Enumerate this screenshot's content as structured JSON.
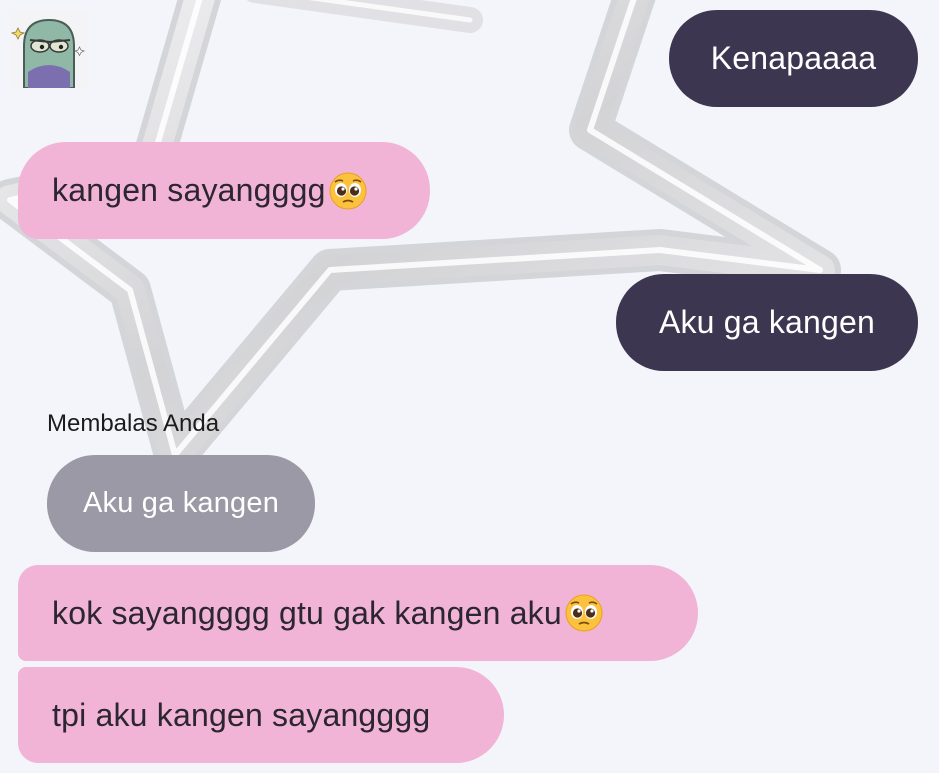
{
  "chat": {
    "contact_avatar": "cartoon-character-avatar",
    "messages": [
      {
        "sender": "me",
        "text": "Kenapaaaa"
      },
      {
        "sender": "contact",
        "text": "kangen sayangggg",
        "emoji": "pleading-face-emoji"
      },
      {
        "sender": "me",
        "text": "Aku ga kangen"
      },
      {
        "sender": "contact",
        "text": "kok sayangggg gtu gak kangen aku ",
        "emoji": "pleading-face-emoji"
      },
      {
        "sender": "contact",
        "text": "tpi aku kangen sayangggg"
      }
    ],
    "reply": {
      "label": "Membalas Anda",
      "quoted_text": "Aku ga kangen"
    }
  },
  "colors": {
    "background": "#f3f5fa",
    "outgoing_bubble": "#3d3650",
    "incoming_bubble": "#f1b3d6",
    "quoted_bubble": "#9c99a6",
    "avatar_skin": "#8fb8a6"
  }
}
